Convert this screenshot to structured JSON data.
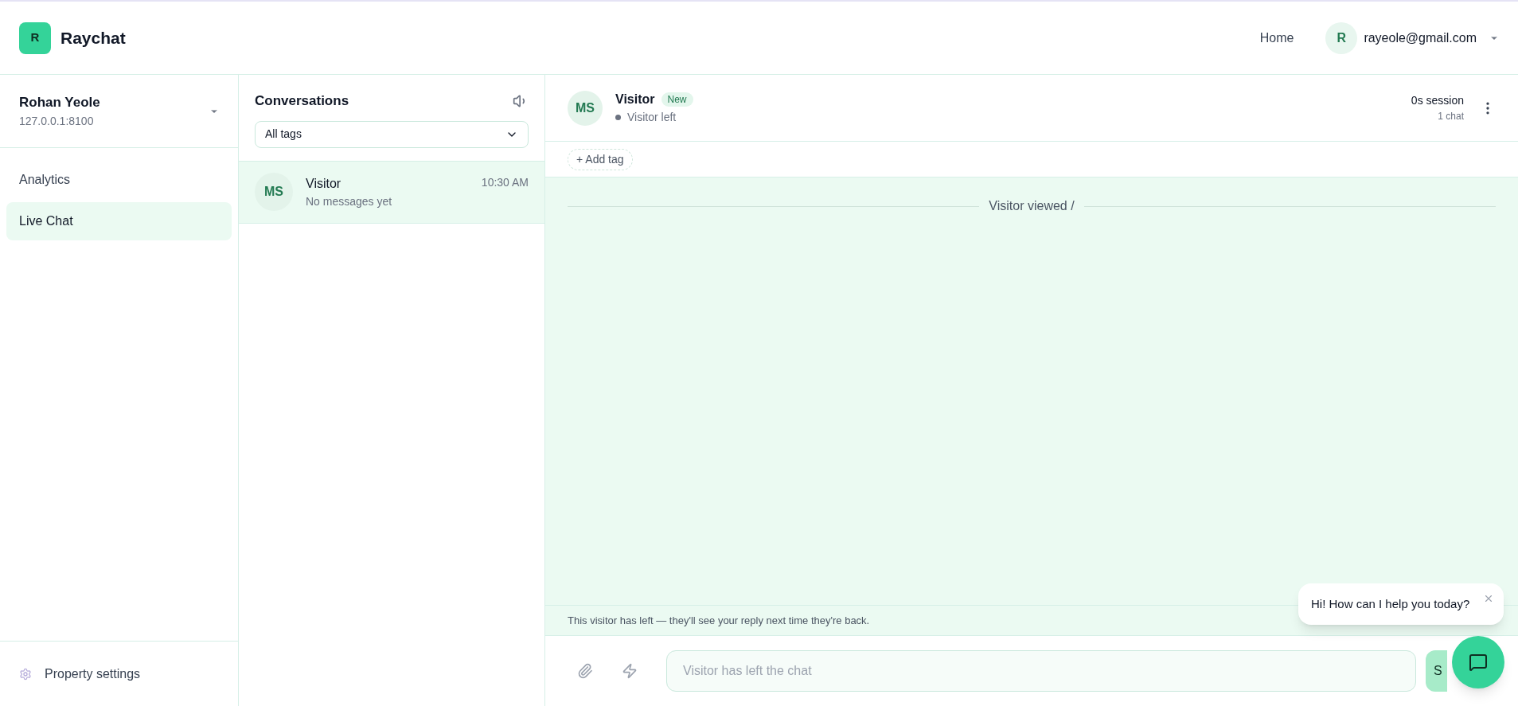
{
  "app": {
    "logo_letter": "R",
    "name": "Raychat"
  },
  "topnav": {
    "links": [
      "Home"
    ],
    "user": {
      "initial": "R",
      "email": "rayeole@gmail.com"
    }
  },
  "sidebar": {
    "account": {
      "name": "Rohan Yeole",
      "address": "127.0.0.1:8100"
    },
    "items": [
      {
        "label": "Analytics",
        "selected": false
      },
      {
        "label": "Live Chat",
        "selected": true
      }
    ],
    "footer": {
      "label": "Property settings"
    }
  },
  "conversations": {
    "title": "Conversations",
    "filter": {
      "value": "All tags"
    },
    "items": [
      {
        "initials": "MS",
        "name": "Visitor",
        "preview": "No messages yet",
        "time": "10:30 AM",
        "selected": true
      }
    ]
  },
  "chat": {
    "visitor": {
      "initials": "MS",
      "name": "Visitor",
      "badge": "New",
      "status": "Visitor left",
      "online": false
    },
    "session": "0s session",
    "chats": "1 chat",
    "add_tag": "+ Add tag",
    "events": [
      "Visitor viewed /"
    ],
    "notice": "This visitor has left — they'll see your reply next time they're back.",
    "composer": {
      "placeholder": "Visitor has left the chat",
      "disabled": true
    },
    "send_label": "S"
  },
  "widget": {
    "greeting": "Hi! How can I help you today?"
  }
}
